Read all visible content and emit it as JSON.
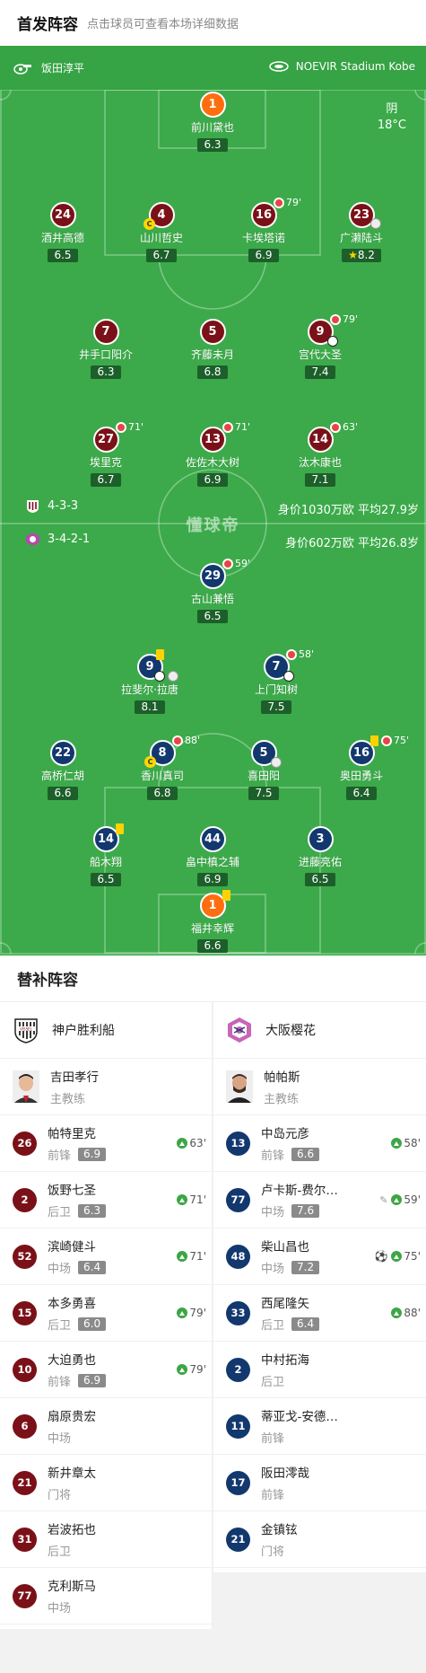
{
  "header": {
    "title": "首发阵容",
    "subtitle": "点击球员可查看本场详细数据"
  },
  "match_info": {
    "referee": "饭田淳平",
    "stadium": "NOEVIR Stadium Kobe",
    "weather": "阴",
    "temperature": "18°C"
  },
  "home": {
    "formation": "4-3-3",
    "value_text": "身价1030万欧  平均27.9岁",
    "color": "#7b1118"
  },
  "away": {
    "formation": "3-4-2-1",
    "value_text": "身价602万欧   平均26.8岁",
    "color": "#13386e"
  },
  "watermark": "懂球帝",
  "pitch_players": {
    "h1": {
      "num": "1",
      "name": "前川黛也",
      "rating": "6.3"
    },
    "h24": {
      "num": "24",
      "name": "酒井高德",
      "rating": "6.5"
    },
    "h4": {
      "num": "4",
      "name": "山川哲史",
      "rating": "6.7",
      "captain": "C"
    },
    "h16": {
      "num": "16",
      "name": "卡埃塔诺",
      "rating": "6.9",
      "sub_min": "79'"
    },
    "h23": {
      "num": "23",
      "name": "广濑陆斗",
      "rating": "8.2"
    },
    "h7": {
      "num": "7",
      "name": "井手口阳介",
      "rating": "6.3"
    },
    "h5": {
      "num": "5",
      "name": "齐藤未月",
      "rating": "6.8"
    },
    "h9": {
      "num": "9",
      "name": "宫代大圣",
      "rating": "7.4",
      "sub_min": "79'"
    },
    "h27": {
      "num": "27",
      "name": "埃里克",
      "rating": "6.7",
      "sub_min": "71'"
    },
    "h13": {
      "num": "13",
      "name": "佐佐木大树",
      "rating": "6.9",
      "sub_min": "71'"
    },
    "h14": {
      "num": "14",
      "name": "汰木康也",
      "rating": "7.1",
      "sub_min": "63'"
    },
    "a29": {
      "num": "29",
      "name": "古山兼悟",
      "rating": "6.5",
      "sub_min": "59'"
    },
    "a9": {
      "num": "9",
      "name": "拉斐尔·拉唐",
      "rating": "8.1"
    },
    "a7": {
      "num": "7",
      "name": "上门知树",
      "rating": "7.5",
      "sub_min": "58'"
    },
    "a22": {
      "num": "22",
      "name": "高桥仁胡",
      "rating": "6.6"
    },
    "a8": {
      "num": "8",
      "name": "香川真司",
      "rating": "6.8",
      "sub_min": "88'",
      "captain": "C"
    },
    "a5": {
      "num": "5",
      "name": "喜田阳",
      "rating": "7.5"
    },
    "a16": {
      "num": "16",
      "name": "奥田勇斗",
      "rating": "6.4",
      "sub_min": "75'"
    },
    "a14": {
      "num": "14",
      "name": "船木翔",
      "rating": "6.5"
    },
    "a44": {
      "num": "44",
      "name": "畠中槙之辅",
      "rating": "6.9"
    },
    "a3": {
      "num": "3",
      "name": "进藤亮佑",
      "rating": "6.5"
    },
    "a1": {
      "num": "1",
      "name": "福井幸辉",
      "rating": "6.6"
    }
  },
  "subs": {
    "title": "替补阵容",
    "home_team": "神户胜利船",
    "away_team": "大阪樱花",
    "home_coach": {
      "name": "吉田孝行",
      "role": "主教练"
    },
    "away_coach": {
      "name": "帕帕斯",
      "role": "主教练"
    },
    "home_list": [
      {
        "num": "26",
        "name": "帕特里克",
        "pos": "前锋",
        "rating": "6.9",
        "in": "63'"
      },
      {
        "num": "2",
        "name": "饭野七圣",
        "pos": "后卫",
        "rating": "6.3",
        "in": "71'"
      },
      {
        "num": "52",
        "name": "滨崎健斗",
        "pos": "中场",
        "rating": "6.4",
        "in": "71'"
      },
      {
        "num": "15",
        "name": "本多勇喜",
        "pos": "后卫",
        "rating": "6.0",
        "in": "79'"
      },
      {
        "num": "10",
        "name": "大迫勇也",
        "pos": "前锋",
        "rating": "6.9",
        "in": "79'"
      },
      {
        "num": "6",
        "name": "扇原贵宏",
        "pos": "中场"
      },
      {
        "num": "21",
        "name": "新井章太",
        "pos": "门将"
      },
      {
        "num": "31",
        "name": "岩波拓也",
        "pos": "后卫"
      },
      {
        "num": "77",
        "name": "克利斯马",
        "pos": "中场"
      }
    ],
    "away_list": [
      {
        "num": "13",
        "name": "中岛元彦",
        "pos": "前锋",
        "rating": "6.6",
        "in": "58'"
      },
      {
        "num": "77",
        "name": "卢卡斯-费尔…",
        "pos": "中场",
        "rating": "7.6",
        "in": "59'"
      },
      {
        "num": "48",
        "name": "柴山昌也",
        "pos": "中场",
        "rating": "7.2",
        "in": "75'"
      },
      {
        "num": "33",
        "name": "西尾隆矢",
        "pos": "后卫",
        "rating": "6.4",
        "in": "88'"
      },
      {
        "num": "2",
        "name": "中村拓海",
        "pos": "后卫"
      },
      {
        "num": "11",
        "name": "蒂亚戈-安德…",
        "pos": "前锋"
      },
      {
        "num": "17",
        "name": "阪田澪哉",
        "pos": "前锋"
      },
      {
        "num": "21",
        "name": "金镇铉",
        "pos": "门将"
      }
    ]
  }
}
